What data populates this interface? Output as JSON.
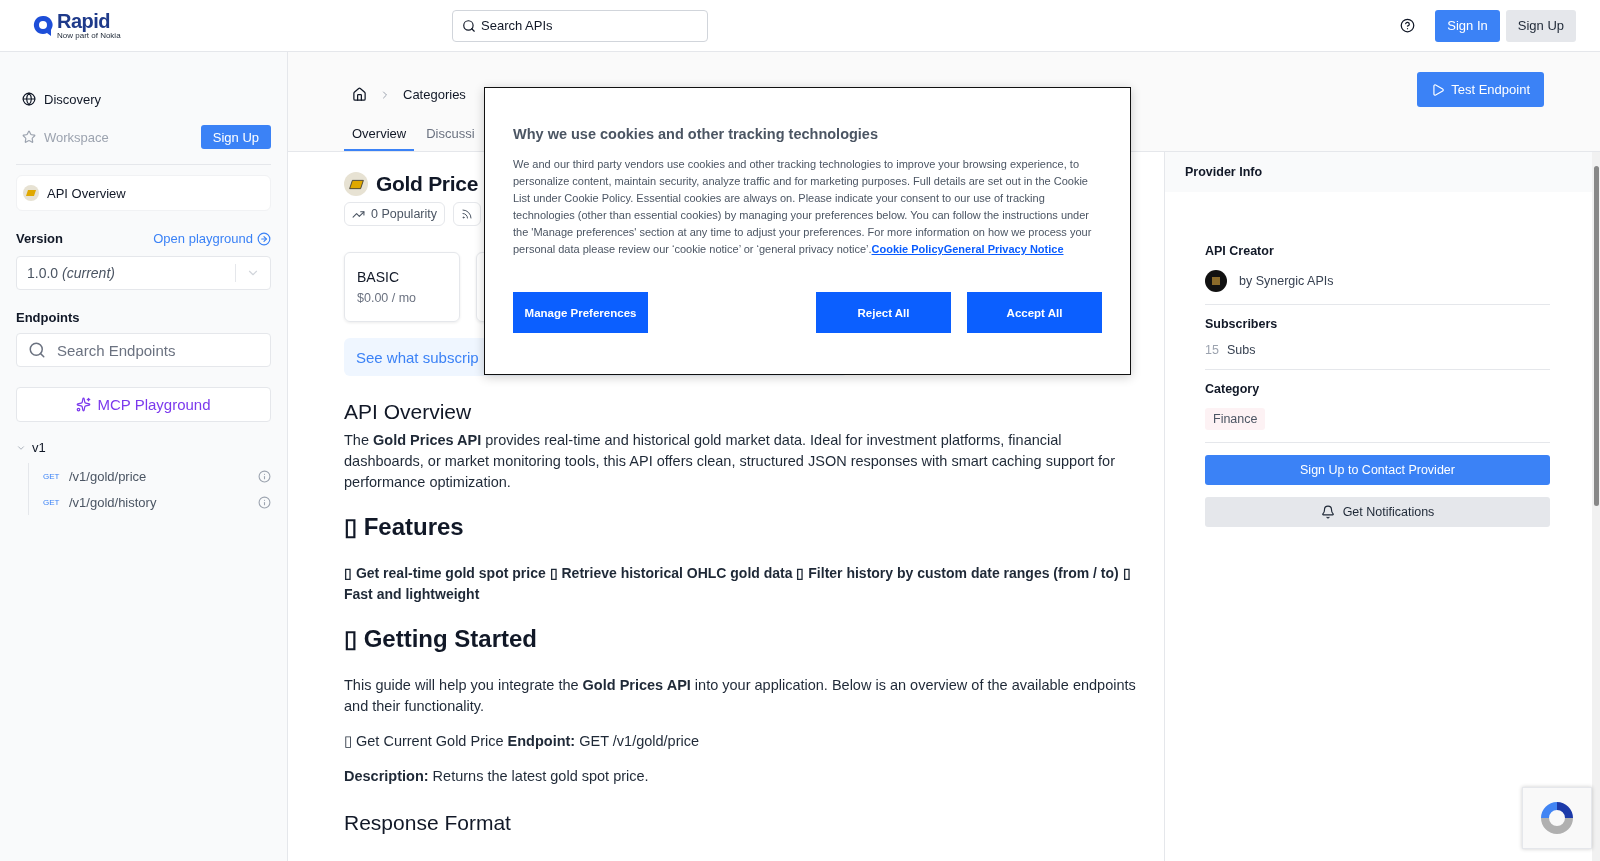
{
  "header": {
    "logo": {
      "name": "Rapid",
      "tagline": "Now part of Nokia"
    },
    "search": {
      "placeholder": "Search APIs"
    },
    "buttons": [
      {
        "label": "Sign In",
        "kind": "primary"
      },
      {
        "label": "Sign Up",
        "kind": "secondary"
      }
    ]
  },
  "sidebar": {
    "nav": [
      {
        "label": "Discovery",
        "disabled": false
      },
      {
        "label": "Workspace",
        "disabled": true
      }
    ],
    "signup_button": "Sign Up",
    "overview_item": {
      "label": "API Overview"
    },
    "version": {
      "label": "Version",
      "link": "Open playground",
      "value": "1.0.0 *(current)*"
    },
    "endpoints": {
      "label": "Endpoints",
      "search_placeholder": "Search Endpoints"
    },
    "mcp_button": "MCP Playground",
    "tree": [
      {
        "label": "v1",
        "expanded": true,
        "children": [
          {
            "method": "GET",
            "path": "/v1/gold/price"
          },
          {
            "method": "GET",
            "path": "/v1/gold/history"
          }
        ]
      }
    ]
  },
  "breadcrumb": [
    "Categories"
  ],
  "tabs": [
    {
      "label": "Overview",
      "selected": true
    },
    {
      "label": "Discussi",
      "selected": false
    }
  ],
  "test_button": "Test Endpoint",
  "api": {
    "title": "Gold Price",
    "badges": [
      {
        "kind": "popularity",
        "label": "0 Popularity"
      },
      {
        "kind": "feed"
      }
    ],
    "plans": [
      {
        "kind": "priced",
        "name": "BASIC",
        "price": "$0.00 / mo"
      },
      {
        "kind": "covered"
      }
    ],
    "banner": "See what subscrip"
  },
  "docs": [
    {
      "kind": "h2",
      "text": "API Overview"
    },
    {
      "kind": "p",
      "text": "The **Gold Prices API** provides real-time and historical gold market data. Ideal for investment platforms, financial dashboards, or market monitoring tools, this API offers clean, structured JSON responses with smart caching support for performance optimization."
    },
    {
      "kind": "h1",
      "text": "▯ Features"
    },
    {
      "kind": "bold",
      "text": "▯ Get real-time gold spot price ▯ Retrieve historical OHLC gold data ▯ Filter history by custom date ranges (from / to) ▯ Fast and lightweight"
    },
    {
      "kind": "h1",
      "text": "▯ Getting Started"
    },
    {
      "kind": "p",
      "text": "This guide will help you integrate the **Gold Prices API** into your application. Below is an overview of the available endpoints and their functionality."
    },
    {
      "kind": "p",
      "text": "▯ Get Current Gold Price **Endpoint:** GET /v1/gold/price"
    },
    {
      "kind": "p",
      "text": "**Description:** Returns the latest gold spot price."
    },
    {
      "kind": "h2",
      "text": "Response Format"
    }
  ],
  "provider": {
    "title": "Provider Info",
    "creator_label": "API Creator",
    "creator": "by Synergic APIs",
    "subscribers_label": "Subscribers",
    "subscribers_count": "15",
    "subscribers_unit": "Subs",
    "category_label": "Category",
    "category": "Finance",
    "contact_button": "Sign Up to Contact Provider",
    "notify_button": "Get Notifications"
  },
  "cookie_dialog": {
    "title": "Why we use cookies and other tracking technologies",
    "body": "We and our third party vendors use cookies and other tracking technologies to improve your browsing experience, to personalize content, maintain security, analyze traffic and for marketing purposes. Full details are set out in the Cookie List under Cookie Policy. Essential cookies are always on. Please indicate your consent to our use of tracking technologies (other than essential cookies) by managing your preferences below. You can follow the instructions under the 'Manage preferences' section at any time to adjust your preferences. For more information on how we process your personal data please review our ‘cookie notice’ or ‘general privacy notice’.",
    "links": [
      "Cookie Policy",
      "General Privacy Notice"
    ],
    "buttons": [
      "Manage Preferences",
      "Reject All",
      "Accept All"
    ]
  }
}
